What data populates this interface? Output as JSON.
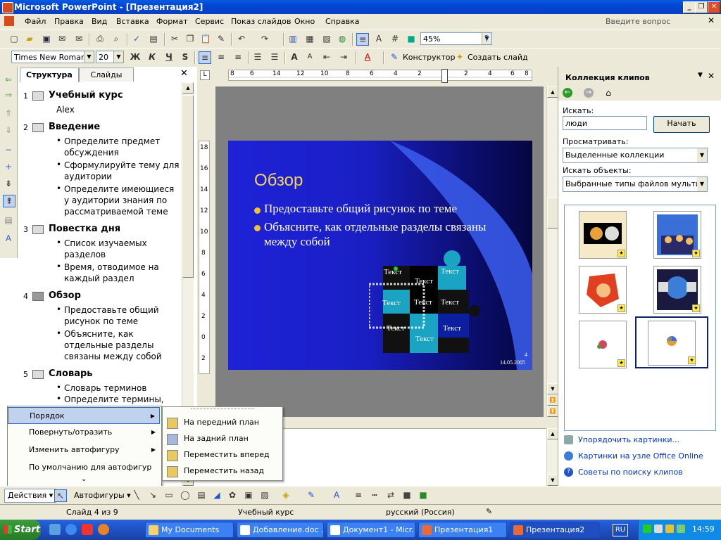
{
  "window": {
    "title": "Microsoft PowerPoint - [Презентация2]"
  },
  "menubar": {
    "items": [
      "Файл",
      "Правка",
      "Вид",
      "Вставка",
      "Формат",
      "Сервис",
      "Показ слайдов",
      "Окно",
      "Справка"
    ],
    "help_placeholder": "Введите вопрос"
  },
  "toolbar_standard": {
    "zoom": "45%"
  },
  "toolbar_format": {
    "font": "Times New Roman",
    "size": "20",
    "bold": "Ж",
    "italic": "К",
    "underline": "Ч",
    "shadow": "S",
    "designer": "Конструктор",
    "new_slide": "Создать слайд"
  },
  "left_pane": {
    "tabs": [
      "Структура",
      "Слайды"
    ],
    "outline": [
      {
        "num": "1",
        "title": "Учебный курс",
        "sub": "Alex",
        "bullets": []
      },
      {
        "num": "2",
        "title": "Введение",
        "bullets": [
          "Определите предмет обсуждения",
          "Сформулируйте тему для аудитории",
          "Определите имеющиеся у аудитории знания по рассматриваемой теме"
        ]
      },
      {
        "num": "3",
        "title": "Повестка дня",
        "bullets": [
          "Список изучаемых разделов",
          "Время, отводимое на каждый раздел"
        ]
      },
      {
        "num": "4",
        "title": "Обзор",
        "bullets": [
          "Предоставьте общий рисунок по теме",
          "Объясните, как отдельные разделы связаны между собой"
        ]
      },
      {
        "num": "5",
        "title": "Словарь",
        "bullets": [
          "Словарь терминов",
          "Определите термины,"
        ]
      }
    ]
  },
  "ruler": {
    "h_labels": [
      "8",
      "6",
      "14",
      "12",
      "10",
      "8",
      "6",
      "4",
      "2",
      "0",
      "2",
      "4",
      "6",
      "8"
    ],
    "v_labels": [
      "18",
      "16",
      "14",
      "12",
      "10",
      "8",
      "6",
      "4",
      "2",
      "0",
      "2"
    ]
  },
  "slide": {
    "title": "Обзор",
    "bullets": [
      "Предоставьте общий рисунок по теме",
      "Объясните, как отдельные разделы связаны между собой"
    ],
    "puzzle_labels": [
      "Текст",
      "Текст",
      "Текст",
      "Текст",
      "Текст",
      "Текст",
      "Текст",
      "Текст"
    ],
    "page_number": "4",
    "date": "14.05.2005"
  },
  "task_pane": {
    "title": "Коллекция клипов",
    "search_label": "Искать:",
    "search_value": "люди",
    "go_button": "Начать",
    "browse_label": "Просматривать:",
    "browse_value": "Выделенные коллекции",
    "objects_label": "Искать объекты:",
    "objects_value": "Выбранные типы файлов мультимед",
    "links": [
      "Упорядочить картинки...",
      "Картинки на узле Office Online",
      "Советы по поиску клипов"
    ]
  },
  "context_menu": {
    "items": [
      "Порядок",
      "Повернуть/отразить",
      "Изменить автофигуру",
      "По умолчанию для автофигур"
    ],
    "submenu": [
      "На передний план",
      "На задний план",
      "Переместить вперед",
      "Переместить назад"
    ]
  },
  "drawing_toolbar": {
    "actions": "Действия",
    "autoshapes": "Автофигуры"
  },
  "status": {
    "slide": "Слайд 4 из 9",
    "design": "Учебный курс",
    "language": "русский (Россия)"
  },
  "taskbar": {
    "start": "Start",
    "tasks": [
      "My Documents",
      "Добавление.doc ...",
      "Документ1 - Micr...",
      "Презентация1",
      "Презентация2"
    ],
    "lang": "RU",
    "time": "14:59"
  }
}
